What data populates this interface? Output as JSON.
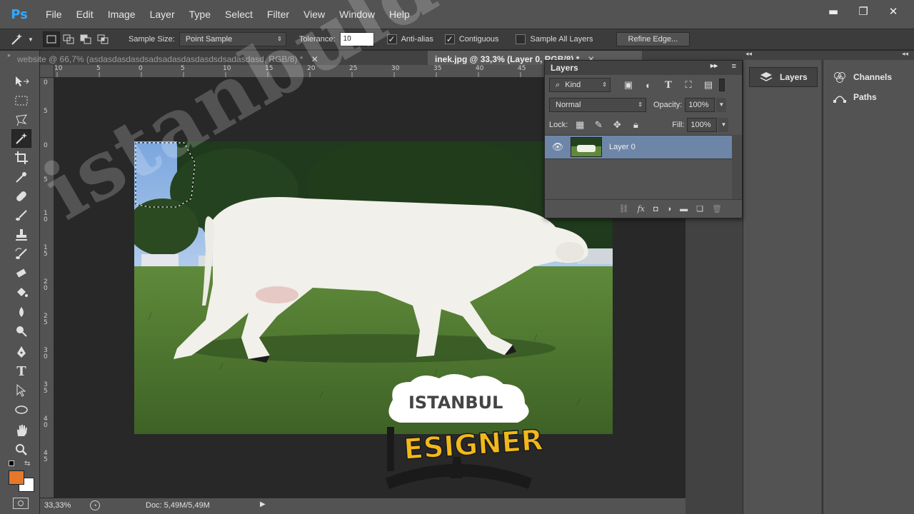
{
  "app": {
    "logo": "Ps"
  },
  "menu": [
    "File",
    "Edit",
    "Image",
    "Layer",
    "Type",
    "Select",
    "Filter",
    "View",
    "Window",
    "Help"
  ],
  "window_controls": {
    "minimize": "▬",
    "maximize": "❐",
    "close": "✕"
  },
  "options": {
    "sample_size_label": "Sample Size:",
    "sample_size_value": "Point Sample",
    "tolerance_label": "Tolerance:",
    "tolerance_value": "10",
    "anti_alias_label": "Anti-alias",
    "anti_alias_checked": true,
    "contiguous_label": "Contiguous",
    "contiguous_checked": true,
    "sample_all_layers_label": "Sample All Layers",
    "sample_all_layers_checked": false,
    "refine_edge_label": "Refine Edge..."
  },
  "tabs": [
    {
      "title": "website @ 66,7% (asdasdasdasdsadsadasdasdasdsdsadasdasd, RGB/8) *",
      "active": false
    },
    {
      "title": "inek.jpg @ 33,3% (Layer 0, RGB/8) *",
      "active": true
    }
  ],
  "ruler_top_labels": [
    "10",
    "5",
    "0",
    "5",
    "10",
    "15",
    "20",
    "25",
    "30",
    "35",
    "40",
    "45"
  ],
  "ruler_left_labels": [
    "0",
    "5",
    "0",
    "5",
    "1 0",
    "1 5",
    "2 0",
    "2 5",
    "3 0",
    "3 5",
    "4 0",
    "4 5"
  ],
  "status": {
    "zoom": "33,33%",
    "doc": "Doc: 5,49M/5,49M"
  },
  "layers_panel": {
    "title": "Layers",
    "kind_label": "Kind",
    "blend_mode": "Normal",
    "opacity_label": "Opacity:",
    "opacity_value": "100%",
    "lock_label": "Lock:",
    "fill_label": "Fill:",
    "fill_value": "100%",
    "layers": [
      {
        "name": "Layer 0",
        "visible": true,
        "selected": true
      }
    ]
  },
  "dock": {
    "layers_label": "Layers",
    "channels_label": "Channels",
    "paths_label": "Paths"
  },
  "colors": {
    "foreground": "#e5782a",
    "background": "#ffffff",
    "accent": "#31a8ff"
  },
  "watermark": {
    "text": "istanbuldesigner.com",
    "logo_top": "ISTANBUL",
    "logo_bottom": "ESIGNER"
  }
}
